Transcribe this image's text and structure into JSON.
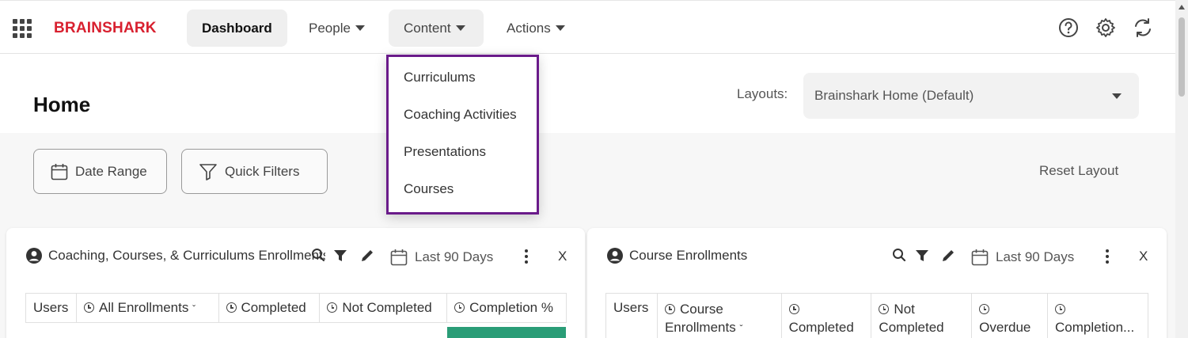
{
  "app": {
    "logo": "BRAINSHARK"
  },
  "nav": {
    "dashboard": "Dashboard",
    "people": "People",
    "content": "Content",
    "actions": "Actions"
  },
  "content_menu": {
    "items": [
      "Curriculums",
      "Coaching Activities",
      "Presentations",
      "Courses"
    ]
  },
  "page": {
    "title": "Home",
    "layouts_label": "Layouts:",
    "layout_value": "Brainshark Home (Default)",
    "reset_layout": "Reset Layout"
  },
  "filters": {
    "date_range": "Date Range",
    "quick_filters": "Quick Filters"
  },
  "card1": {
    "title": "Coaching, Courses, & Curriculums Enrollments",
    "date": "Last 90 Days",
    "close": "X",
    "columns": [
      "Users",
      "All Enrollments",
      "Completed",
      "Not Completed",
      "Completion %"
    ]
  },
  "card2": {
    "title": "Course Enrollments",
    "date": "Last 90 Days",
    "close": "X",
    "columns": {
      "users": "Users",
      "course_l1": "Course",
      "course_l2": "Enrollments",
      "completed": "Completed",
      "not_l1": "Not",
      "not_l2": "Completed",
      "overdue": "Overdue",
      "completion": "Completion..."
    }
  },
  "colors": {
    "brand": "#d8202f",
    "menu_border": "#6a1b8a",
    "completion_fill": "#2a9d77"
  }
}
